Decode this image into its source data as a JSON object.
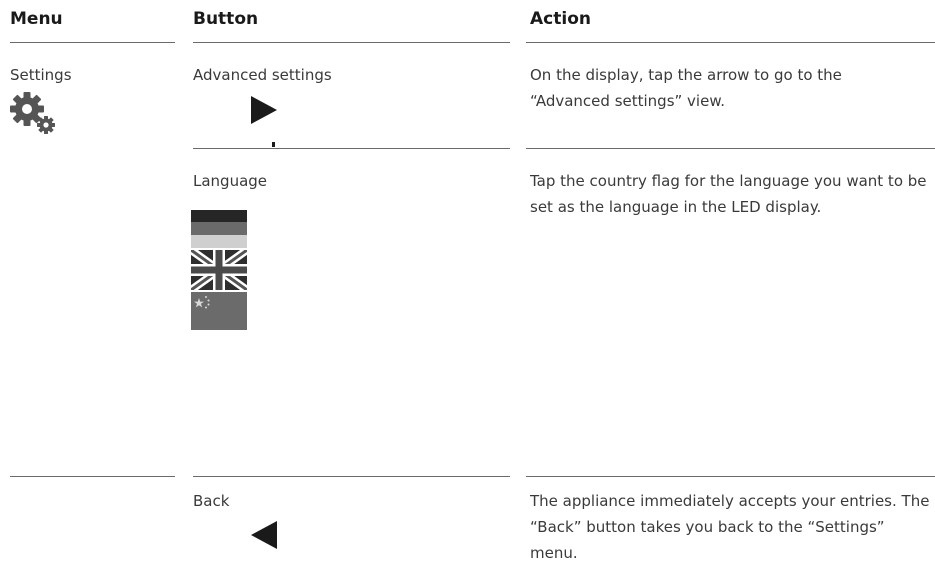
{
  "headers": {
    "menu": "Menu",
    "button": "Button",
    "action": "Action"
  },
  "rows": [
    {
      "menu": "Settings",
      "button": "Advanced settings",
      "action": "On the display, tap the arrow to go to the “Advanced settings” view."
    },
    {
      "button": "Language",
      "action": "Tap the country flag for the language you want to be set as the language in the LED display."
    },
    {
      "button": "Back",
      "action": "The appliance immediately accepts your entries. The “Back” button takes you back to the “Settings” menu."
    }
  ],
  "icons": {
    "settings": "gears-icon",
    "forward": "play-arrow-right-icon",
    "back": "arrow-left-icon",
    "flags": [
      "german-flag-icon",
      "uk-flag-icon",
      "china-flag-icon"
    ]
  }
}
